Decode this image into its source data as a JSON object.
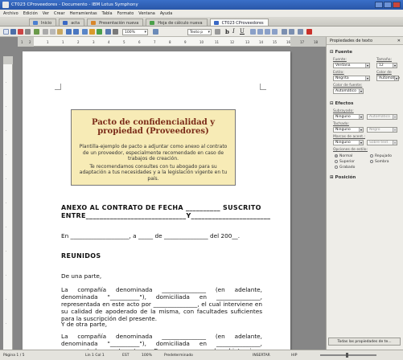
{
  "window": {
    "title": "CT023 CProveedores - Documento - IBM Lotus Symphony"
  },
  "menu": [
    "Archivo",
    "Edición",
    "Ver",
    "Crear",
    "Herramientas",
    "Tabla",
    "Formato",
    "Ventana",
    "Ayuda"
  ],
  "tabs": [
    {
      "label": "Inicio",
      "color": "#4b7fd0"
    },
    {
      "label": "acta",
      "color": "#3a68c4"
    },
    {
      "label": "Presentación nueva",
      "color": "#d8862a"
    },
    {
      "label": "Hoja de cálculo nueva",
      "color": "#4aa04a"
    },
    {
      "label": "CT023 CProveedores",
      "color": "#3a68c4"
    }
  ],
  "toolbar": {
    "zoom": "100%",
    "style": "Texto p",
    "bold": "b",
    "italic": "I",
    "underline": "U"
  },
  "ruler": {
    "h": [
      "1",
      "2",
      "1",
      "1",
      "2",
      "3",
      "4",
      "5",
      "6",
      "7",
      "8",
      "9",
      "10",
      "11",
      "12",
      "13",
      "14",
      "15",
      "16",
      "17",
      "18"
    ]
  },
  "document": {
    "title": "Pacto de confidencialidad y propiedad (Proveedores)",
    "note1": "Plantilla-ejemplo de pacto a adjuntar como anexo al contrato de un proveedor, especialmente recomendado en caso de trabajos de creación.",
    "note2": "Te recomendamos consultes con tu abogado para su adaptación a tus necesidades y a la legislación vigente en tu país.",
    "anexo_line1": "ANEXO AL CONTRATO DE FECHA __________ SUSCRITO",
    "anexo_line2": "ENTRE_____________________________Y__________________________.",
    "date_line": "En ____________________, a _____ de _______________ del 200__.",
    "reunidos": "REUNIDOS",
    "parte1": "De una parte,",
    "p1": "La compañía denominada _______________ (en adelante, denominada \"__________\"), domiciliada en _______________, representada en este acto por _______________, el cual interviene en su calidad de apoderado de la misma, con facultades suficientes para la suscripción del presente.",
    "parte2": "Y de otra parte,",
    "p2": "La compañía denominada _______________ (en adelante, denominada \"__________\"), domiciliada en _______________, representada en este acto por D. _______________, el cual interviene en su calidad de apoderado de la misma, con facultades suficientes para la suscripción"
  },
  "sidebar": {
    "title": "Propiedades de texto",
    "fuente": "Fuente",
    "fuente_label": "Fuente:",
    "fuente_value": "Verdana",
    "tamano_label": "Tamaño:",
    "tamano_value": "12",
    "estilo_label": "Estilo:",
    "estilo_value": "Negrita",
    "color_fondo_label": "Color de fondo:",
    "color_fondo_value": "Automático",
    "color_fuente_label": "Color de fuente:",
    "color_fuente_value": "Automático",
    "efectos": "Efectos",
    "subrayado_label": "Subrayado:",
    "subrayado_value": "Ninguno",
    "subrayado_color": "Automático",
    "tachado_label": "Tachado:",
    "tachado_value": "Ninguno",
    "tachado_color": "Negro",
    "marcas_label": "Marcas de acent.:",
    "marcas_value": "Ninguno",
    "marcas_pos": "Sobre text",
    "opciones_label": "Opciones de estilo:",
    "radio_normal": "Normal",
    "radio_superior": "Superior",
    "radio_grabado": "Grabado",
    "radio_repujado": "Repujado",
    "radio_sombra": "Sombra",
    "posicion": "Posición",
    "all_props": "Todas las propiedades de te..."
  },
  "status": {
    "page": "Página 1 / 5",
    "lincol": "Lin 1 Col 1",
    "est": "EST",
    "zoom": "100%",
    "style": "Predeterminado",
    "mode": "INSERTAR",
    "hip": "HIP"
  }
}
